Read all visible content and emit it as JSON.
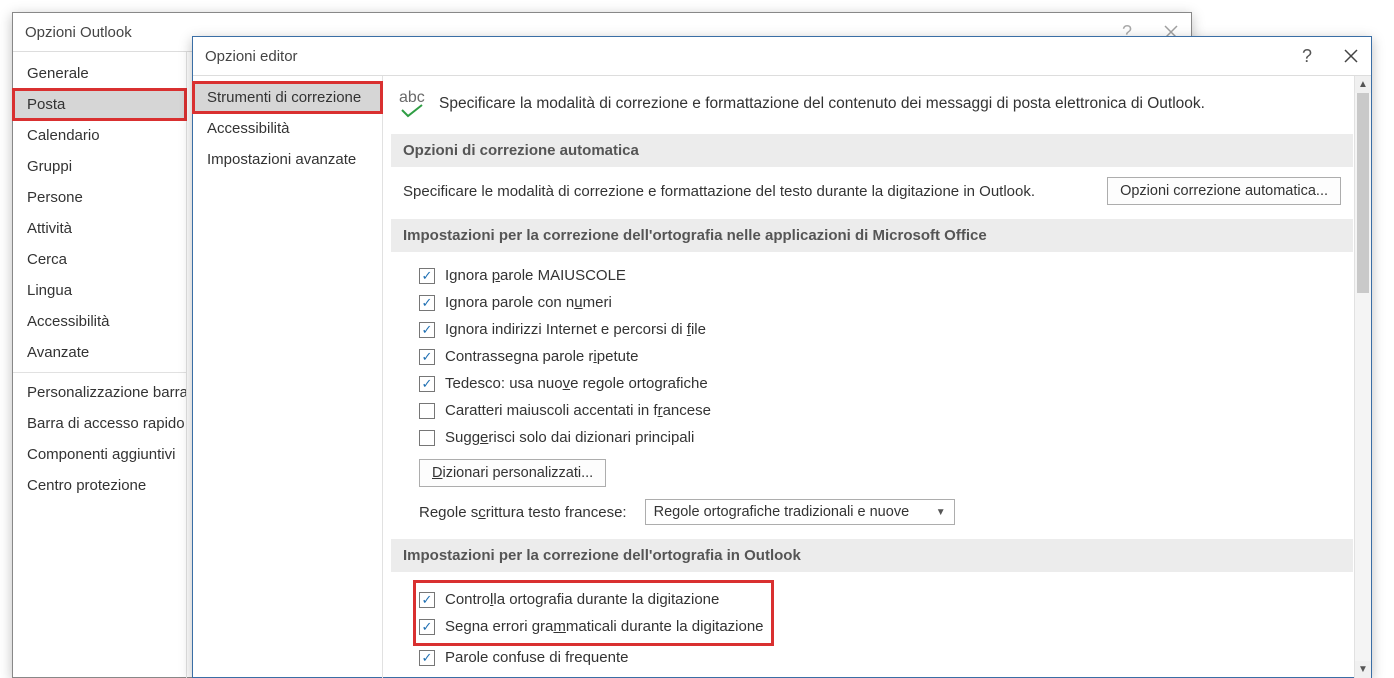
{
  "outlook": {
    "title": "Opzioni Outlook",
    "sidebar": [
      "Generale",
      "Posta",
      "Calendario",
      "Gruppi",
      "Persone",
      "Attività",
      "Cerca",
      "Lingua",
      "Accessibilità",
      "Avanzate"
    ],
    "sidebar2": [
      "Personalizzazione barra",
      "Barra di accesso rapido",
      "Componenti aggiuntivi",
      "Centro protezione"
    ],
    "active_index": 1
  },
  "editor": {
    "title": "Opzioni editor",
    "sidebar": [
      "Strumenti di correzione",
      "Accessibilità",
      "Impostazioni avanzate"
    ],
    "active_index": 0,
    "intro": "Specificare la modalità di correzione e formattazione del contenuto dei messaggi di posta elettronica di Outlook.",
    "abc_label": "abc",
    "section_autocorrect": {
      "header": "Opzioni di correzione automatica",
      "text": "Specificare le modalità di correzione e formattazione del testo durante la digitazione in Outlook.",
      "button": "Opzioni correzione automatica..."
    },
    "section_spell_office": {
      "header": "Impostazioni per la correzione dell'ortografia nelle applicazioni di Microsoft Office",
      "items": [
        {
          "label": "Ignora parole MAIUSCOLE",
          "checked": true,
          "u_after": "Ignora "
        },
        {
          "label": "Ignora parole con numeri",
          "checked": true,
          "u_after": "Ignora parole con n"
        },
        {
          "label": "Ignora indirizzi Internet e percorsi di file",
          "checked": true,
          "u_after": "Ignora indirizzi Internet e percorsi di "
        },
        {
          "label": "Contrassegna parole ripetute",
          "checked": true,
          "u_after": "Contrassegna parole r"
        },
        {
          "label": "Tedesco: usa nuove regole ortografiche",
          "checked": true,
          "u_after": "Tedesco: usa nuo"
        },
        {
          "label": "Caratteri maiuscoli accentati in francese",
          "checked": false,
          "u_after": "Caratteri maiuscoli accentati in f"
        },
        {
          "label": "Suggerisci solo dai dizionari principali",
          "checked": false,
          "u_after": "Sugg"
        }
      ],
      "dict_button": "Dizionari personalizzati...",
      "french_label": "Regole scrittura testo francese:",
      "french_value": "Regole ortografiche tradizionali e nuove"
    },
    "section_spell_outlook": {
      "header": "Impostazioni per la correzione dell'ortografia in Outlook",
      "highlighted": [
        {
          "label": "Controlla ortografia durante la digitazione",
          "checked": true
        },
        {
          "label": "Segna errori grammaticali durante la digitazione",
          "checked": true
        }
      ],
      "extra": [
        {
          "label": "Parole confuse di frequente",
          "checked": true
        }
      ]
    }
  }
}
